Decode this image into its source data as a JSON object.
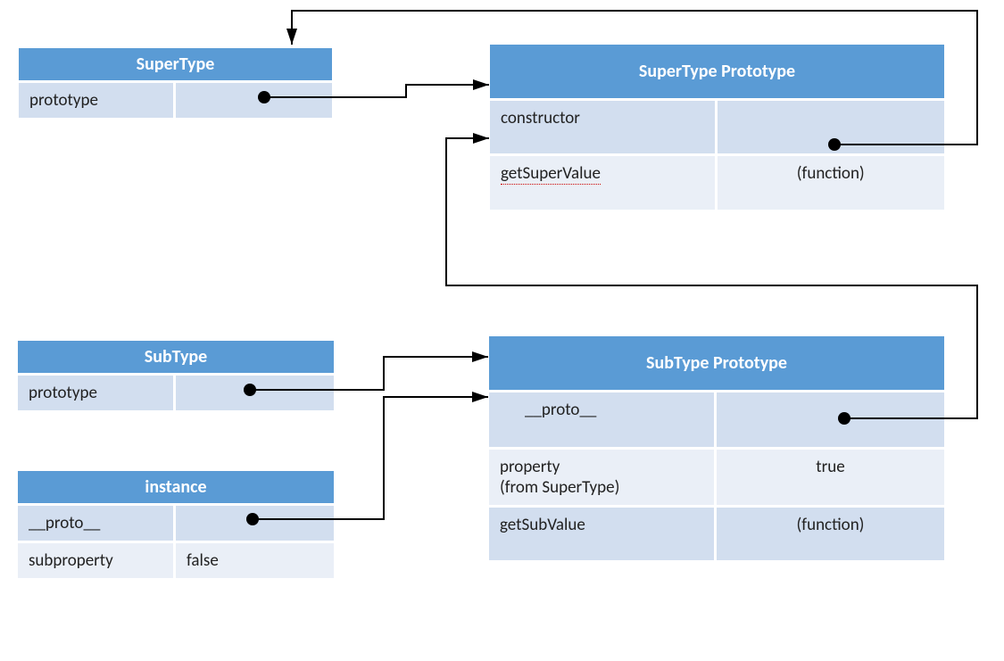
{
  "supertype": {
    "title": "SuperType",
    "rows": [
      {
        "key": "prototype",
        "val": ""
      }
    ]
  },
  "supertype_proto": {
    "title": "SuperType Prototype",
    "rows": [
      {
        "key": "constructor",
        "val": ""
      },
      {
        "key": "getSuperValue",
        "val": "(function)"
      }
    ]
  },
  "subtype": {
    "title": "SubType",
    "rows": [
      {
        "key": "prototype",
        "val": ""
      }
    ]
  },
  "subtype_proto": {
    "title": "SubType Prototype",
    "rows": [
      {
        "key": "__proto__",
        "val": ""
      },
      {
        "key": "property\n(from SuperType)",
        "val": "true"
      },
      {
        "key": "getSubValue",
        "val": "(function)"
      }
    ]
  },
  "instance": {
    "title": "instance",
    "rows": [
      {
        "key": "__proto__",
        "val": ""
      },
      {
        "key": "subproperty",
        "val": "false"
      }
    ]
  }
}
